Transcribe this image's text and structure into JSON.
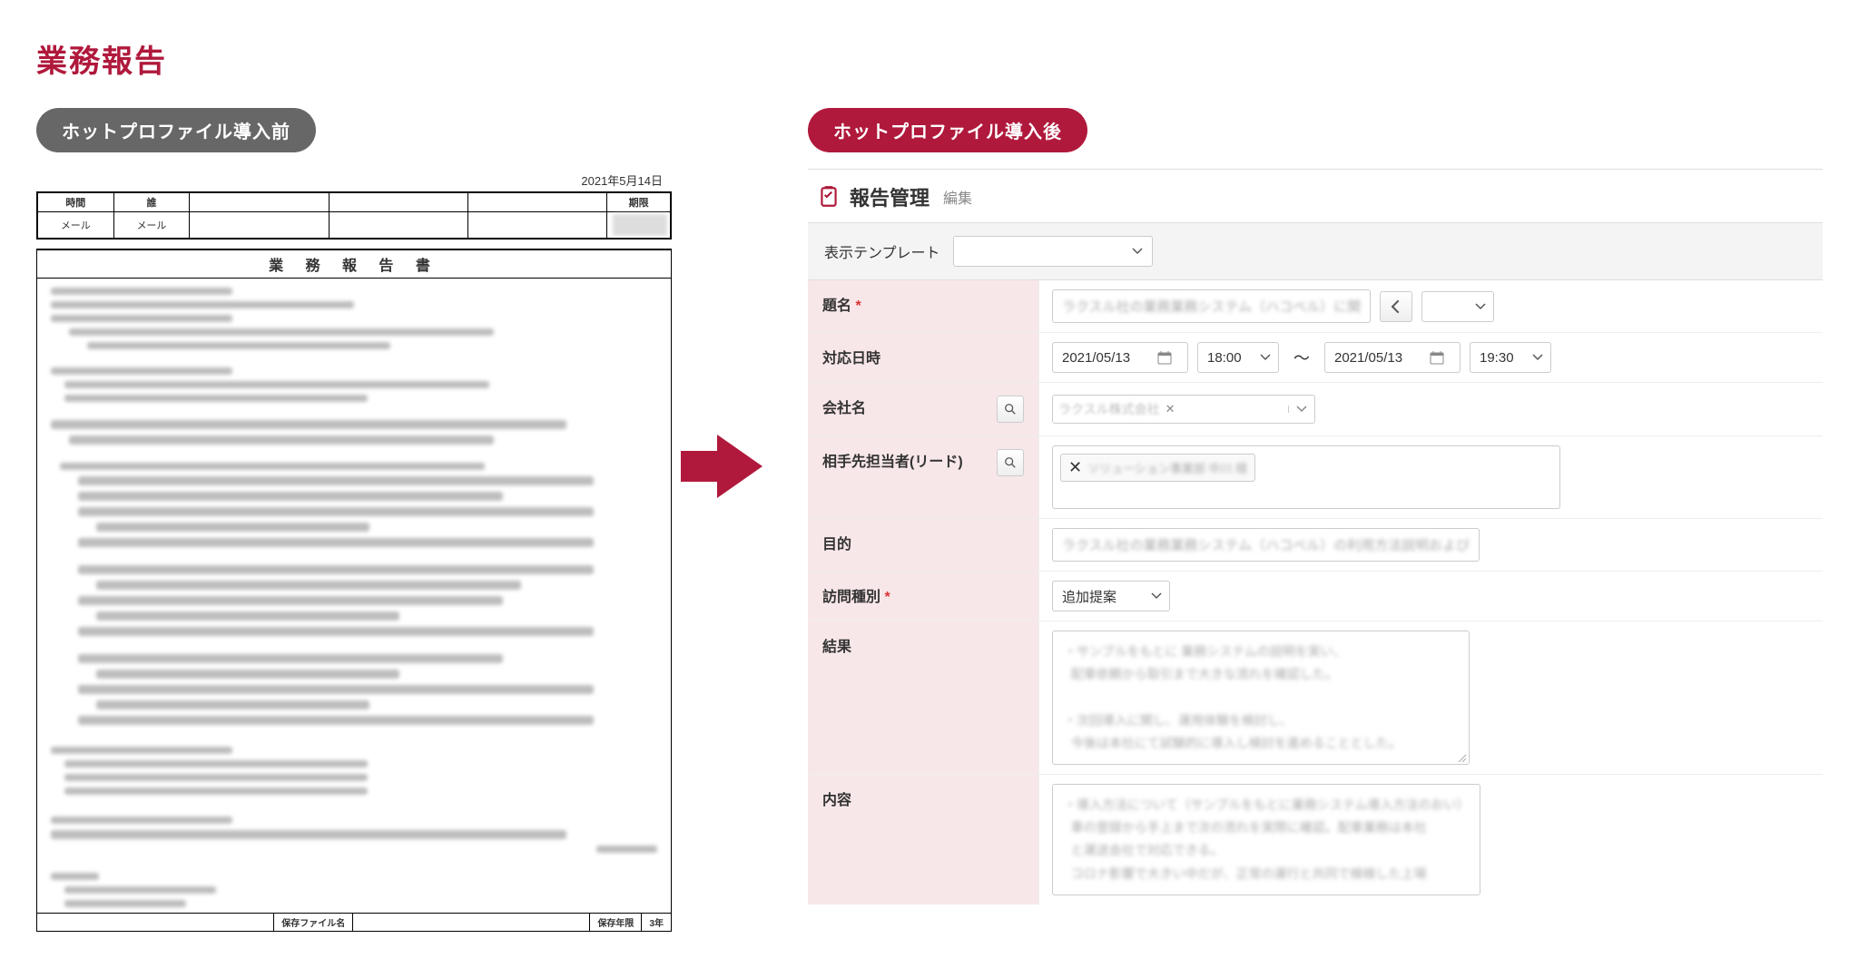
{
  "page_title": "業務報告",
  "before": {
    "badge": "ホットプロファイル導入前",
    "doc_date": "2021年5月14日",
    "table_headers": [
      "時間",
      "誰",
      "",
      "",
      "",
      "期限"
    ],
    "table_row": [
      "メール",
      "メール",
      "",
      "",
      "",
      ""
    ],
    "doc_title": "業 務 報 告 書",
    "footer_left": "保存ファイル名",
    "footer_mid": "保存年限",
    "footer_right": "3年"
  },
  "after": {
    "badge": "ホットプロファイル導入後",
    "panel_title": "報告管理",
    "panel_sub": "編集",
    "template_label": "表示テンプレート",
    "template_value": "",
    "fields": {
      "title_label": "題名",
      "title_value": "",
      "date_label": "対応日時",
      "date_from": "2021/05/13",
      "time_from": "18:00",
      "date_to": "2021/05/13",
      "time_to": "19:30",
      "tilde": "〜",
      "company_label": "会社名",
      "company_value": "",
      "lead_label": "相手先担当者(リード)",
      "lead_value": "",
      "purpose_label": "目的",
      "purpose_value": "",
      "visit_type_label": "訪問種別",
      "visit_type_value": "追加提案",
      "result_label": "結果",
      "content_label": "内容"
    }
  }
}
